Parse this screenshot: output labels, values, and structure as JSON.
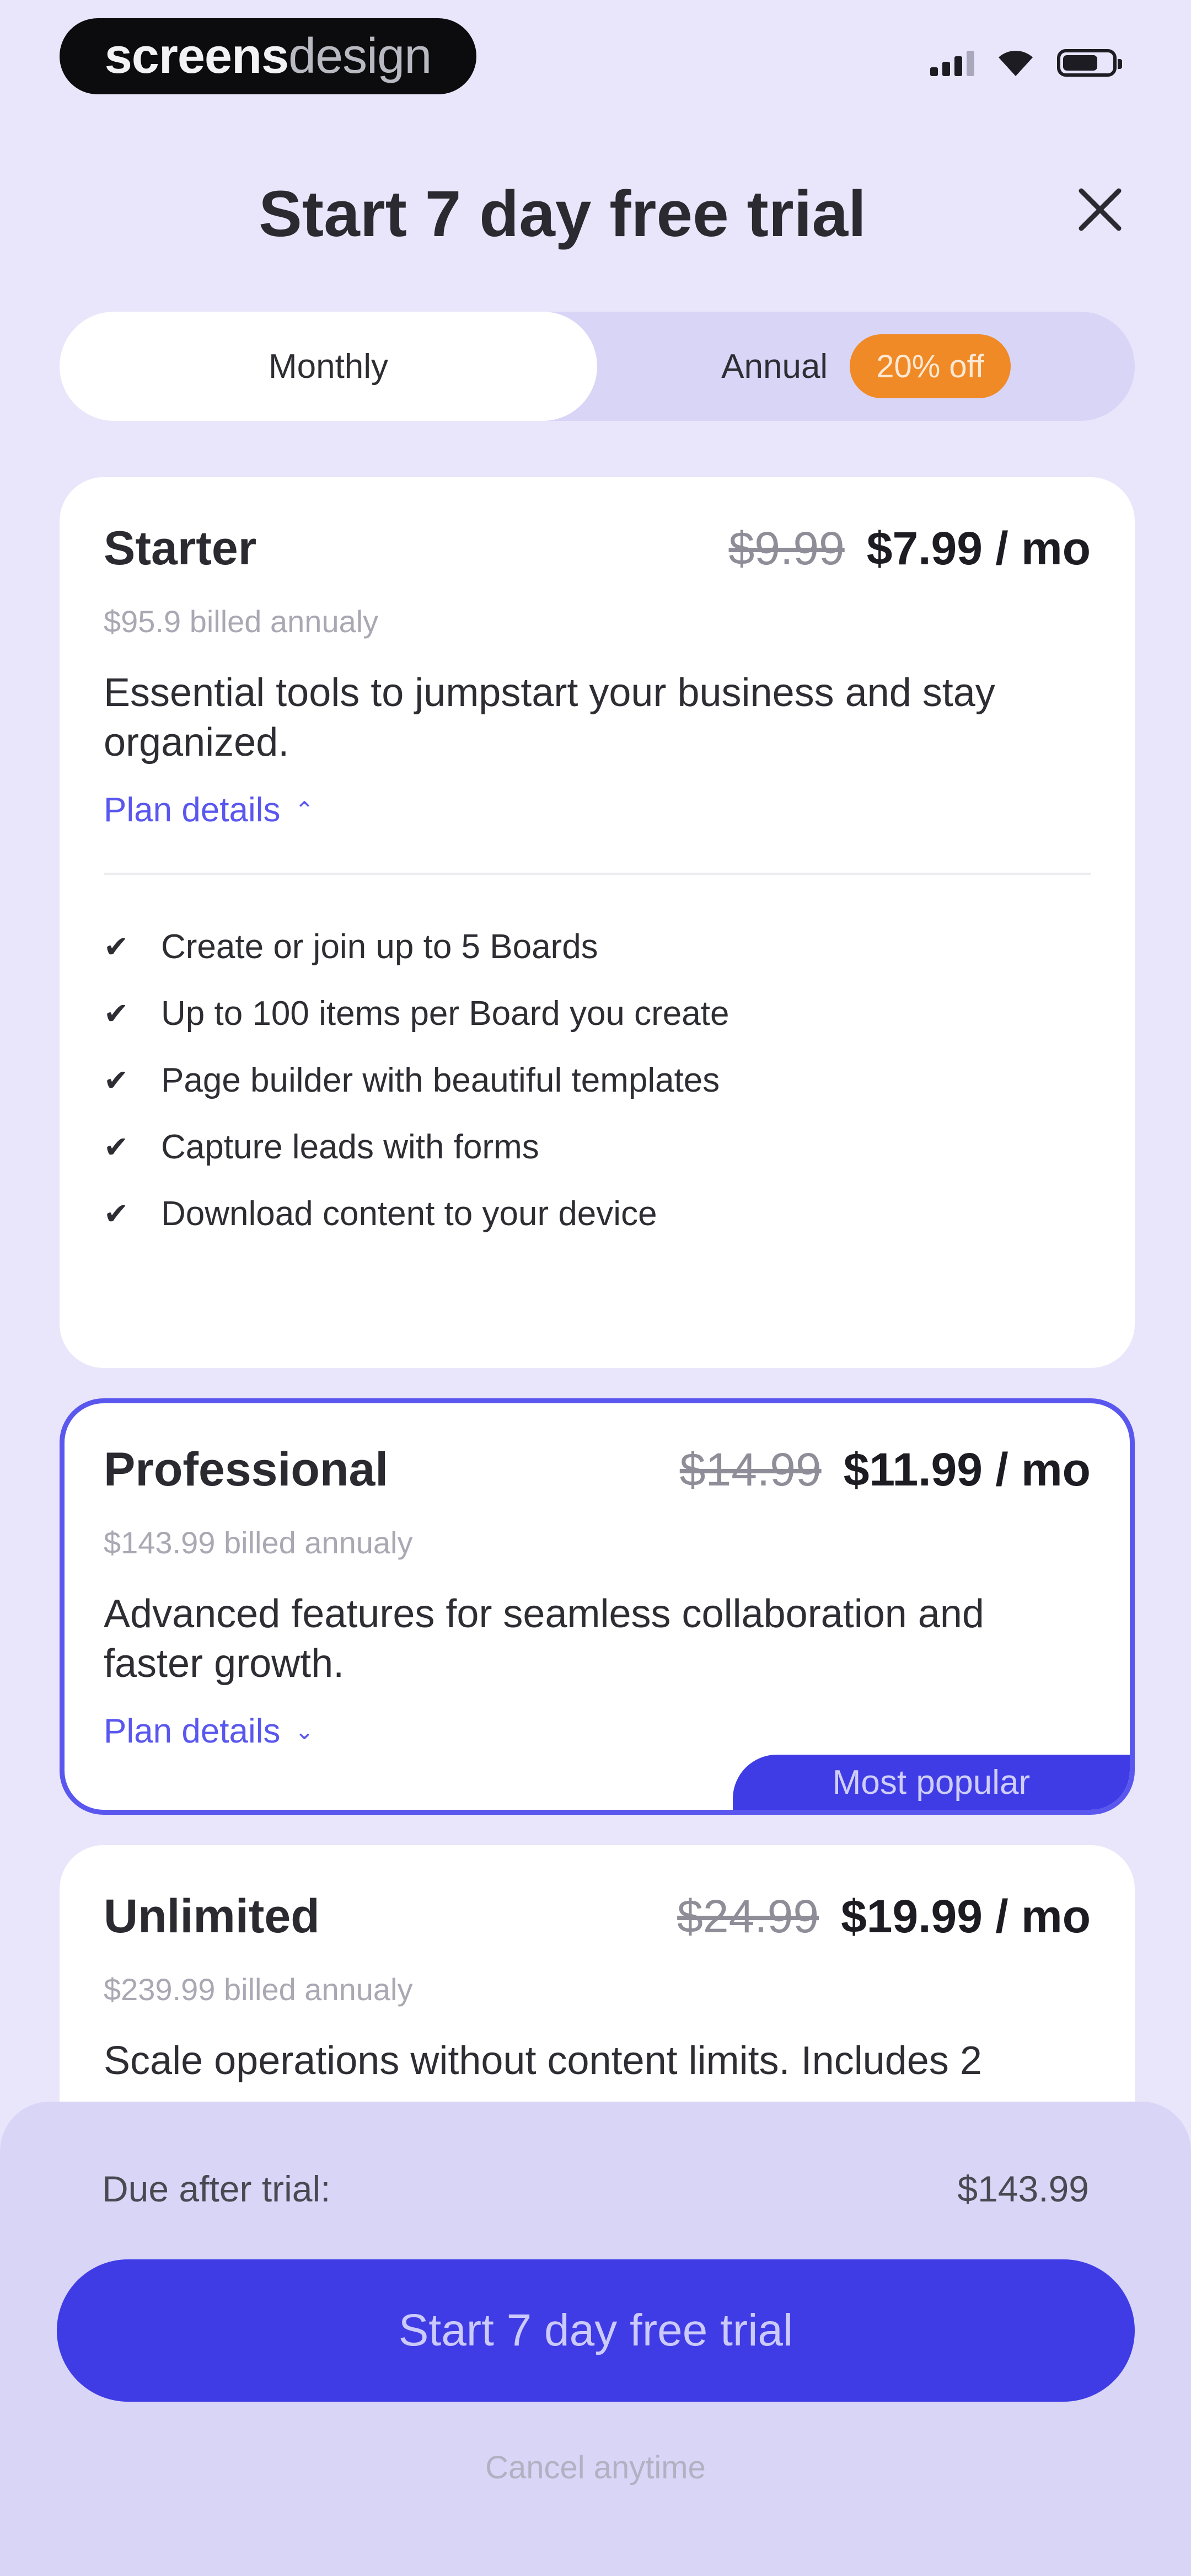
{
  "status_bar": {
    "brand_part1": "screens",
    "brand_part2": "design",
    "icons": [
      "signal-icon",
      "wifi-icon",
      "battery-icon"
    ]
  },
  "header": {
    "title": "Start 7 day free trial",
    "close_icon": "close-icon"
  },
  "billing_toggle": {
    "monthly_label": "Monthly",
    "annual_label": "Annual",
    "discount_badge": "20% off",
    "selected": "Annual"
  },
  "plans": [
    {
      "name": "Starter",
      "old_price": "$9.99",
      "new_price": "$7.99 / mo",
      "billed_note": "$95.9 billed annualy",
      "description": "Essential tools to jumpstart your business and stay organized.",
      "details_label": "Plan details",
      "expanded": true,
      "features": [
        "Create or join up to 5 Boards",
        "Up to 100 items per Board you create",
        "Page builder with beautiful templates",
        "Capture leads with forms",
        "Download content to your device"
      ]
    },
    {
      "name": "Professional",
      "old_price": "$14.99",
      "new_price": "$11.99 / mo",
      "billed_note": "$143.99 billed annualy",
      "description": "Advanced features for seamless collaboration and faster growth.",
      "details_label": "Plan details",
      "expanded": false,
      "badge": "Most popular",
      "selected": true
    },
    {
      "name": "Unlimited",
      "old_price": "$24.99",
      "new_price": "$19.99 / mo",
      "billed_note": "$239.99 billed annualy",
      "description": "Scale operations without content limits. Includes 2"
    }
  ],
  "footer": {
    "due_label": "Due after trial:",
    "due_amount": "$143.99",
    "cta_label": "Start 7 day free trial",
    "cancel_note": "Cancel anytime"
  },
  "colors": {
    "background": "#e9e6fb",
    "accent": "#3f3ce6",
    "badge_orange": "#ef8a26",
    "card": "#ffffff"
  }
}
